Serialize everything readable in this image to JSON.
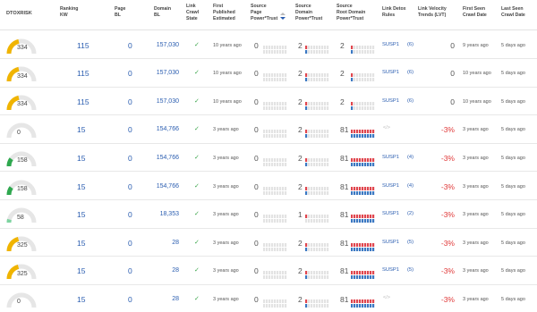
{
  "headers": {
    "dtoxrisk": "DTOXRISK",
    "ranking_kw": [
      "Ranking",
      "KW"
    ],
    "page_bl": [
      "Page",
      "BL"
    ],
    "domain_bl": [
      "Domain",
      "BL"
    ],
    "link_crawl_state": [
      "Link",
      "Crawl",
      "State"
    ],
    "first_published": [
      "First",
      "Published",
      "Estimated"
    ],
    "source_page_pt": [
      "Source",
      "Page",
      "Power*Trust"
    ],
    "source_domain_pt": [
      "Source",
      "Domain",
      "Power*Trust"
    ],
    "source_root_domain_pt": [
      "Source",
      "Root Domain",
      "Power*Trust"
    ],
    "link_detox_rules": [
      "Link Detox",
      "Rules"
    ],
    "link_velocity": [
      "Link Velocity",
      "Trends (LVT)"
    ],
    "first_seen": [
      "First Seen",
      "Crawl Date"
    ],
    "last_seen": [
      "Last Seen",
      "Crawl Date"
    ]
  },
  "colors": {
    "gauge_track": "#e6e6e6",
    "gauge_yellow": "#f0b400",
    "gauge_green": "#2fa84f",
    "gauge_lightgreen": "#7dd3a0",
    "link_blue": "#2a5db0",
    "lvt_red": "#e03a3a",
    "bar_red": "#e0464e",
    "bar_blue": "#3b78c2",
    "bar_empty": "#e3e3e3",
    "check_green": "#3aa54a"
  },
  "rows": [
    {
      "risk": "334",
      "risk_level": 0.43,
      "risk_color": "yellow",
      "ranking_kw": "115",
      "page_bl": "0",
      "domain_bl": "157,030",
      "crawl_state": "ok",
      "first_published": "10 years ago",
      "page_pt": "0",
      "domain_pt": "2",
      "root_pt": "2",
      "domain_red": 1,
      "domain_blue": 1,
      "root_red": 1,
      "root_blue": 1,
      "rules": "SUSP1",
      "rules_count": "(6)",
      "lvt": "0",
      "first_seen": "9 years ago",
      "last_seen": "5 days ago"
    },
    {
      "risk": "334",
      "risk_level": 0.43,
      "risk_color": "yellow",
      "ranking_kw": "115",
      "page_bl": "0",
      "domain_bl": "157,030",
      "crawl_state": "ok",
      "first_published": "10 years ago",
      "page_pt": "0",
      "domain_pt": "2",
      "root_pt": "2",
      "domain_red": 1,
      "domain_blue": 1,
      "root_red": 1,
      "root_blue": 1,
      "rules": "SUSP1",
      "rules_count": "(6)",
      "lvt": "0",
      "first_seen": "10 years ago",
      "last_seen": "5 days ago"
    },
    {
      "risk": "334",
      "risk_level": 0.43,
      "risk_color": "yellow",
      "ranking_kw": "115",
      "page_bl": "0",
      "domain_bl": "157,030",
      "crawl_state": "ok",
      "first_published": "10 years ago",
      "page_pt": "0",
      "domain_pt": "2",
      "root_pt": "2",
      "domain_red": 1,
      "domain_blue": 1,
      "root_red": 1,
      "root_blue": 1,
      "rules": "SUSP1",
      "rules_count": "(6)",
      "lvt": "0",
      "first_seen": "10 years ago",
      "last_seen": "5 days ago"
    },
    {
      "risk": "0",
      "risk_level": 0.0,
      "risk_color": "yellow",
      "ranking_kw": "15",
      "page_bl": "0",
      "domain_bl": "154,766",
      "crawl_state": "ok",
      "first_published": "3 years ago",
      "page_pt": "0",
      "domain_pt": "2",
      "root_pt": "81",
      "domain_red": 1,
      "domain_blue": 1,
      "root_red": 9,
      "root_blue": 9,
      "rules": "",
      "rules_count": "",
      "lvt": "-3%",
      "first_seen": "3 years ago",
      "last_seen": "5 days ago"
    },
    {
      "risk": "158",
      "risk_level": 0.2,
      "risk_color": "green",
      "ranking_kw": "15",
      "page_bl": "0",
      "domain_bl": "154,766",
      "crawl_state": "ok",
      "first_published": "3 years ago",
      "page_pt": "0",
      "domain_pt": "2",
      "root_pt": "81",
      "domain_red": 1,
      "domain_blue": 1,
      "root_red": 9,
      "root_blue": 9,
      "rules": "SUSP1",
      "rules_count": "(4)",
      "lvt": "-3%",
      "first_seen": "3 years ago",
      "last_seen": "5 days ago"
    },
    {
      "risk": "158",
      "risk_level": 0.2,
      "risk_color": "green",
      "ranking_kw": "15",
      "page_bl": "0",
      "domain_bl": "154,766",
      "crawl_state": "ok",
      "first_published": "3 years ago",
      "page_pt": "0",
      "domain_pt": "2",
      "root_pt": "81",
      "domain_red": 1,
      "domain_blue": 1,
      "root_red": 9,
      "root_blue": 9,
      "rules": "SUSP1",
      "rules_count": "(4)",
      "lvt": "-3%",
      "first_seen": "3 years ago",
      "last_seen": "5 days ago"
    },
    {
      "risk": "58",
      "risk_level": 0.08,
      "risk_color": "lightgreen",
      "ranking_kw": "15",
      "page_bl": "0",
      "domain_bl": "18,353",
      "crawl_state": "ok",
      "first_published": "3 years ago",
      "page_pt": "0",
      "domain_pt": "1",
      "root_pt": "81",
      "domain_red": 1,
      "domain_blue": 0,
      "root_red": 9,
      "root_blue": 9,
      "rules": "SUSP1",
      "rules_count": "(2)",
      "lvt": "-3%",
      "first_seen": "3 years ago",
      "last_seen": "5 days ago"
    },
    {
      "risk": "325",
      "risk_level": 0.42,
      "risk_color": "yellow",
      "ranking_kw": "15",
      "page_bl": "0",
      "domain_bl": "28",
      "crawl_state": "ok",
      "first_published": "3 years ago",
      "page_pt": "0",
      "domain_pt": "2",
      "root_pt": "81",
      "domain_red": 1,
      "domain_blue": 1,
      "root_red": 9,
      "root_blue": 9,
      "rules": "SUSP1",
      "rules_count": "(5)",
      "lvt": "-3%",
      "first_seen": "3 years ago",
      "last_seen": "5 days ago"
    },
    {
      "risk": "325",
      "risk_level": 0.42,
      "risk_color": "yellow",
      "ranking_kw": "15",
      "page_bl": "0",
      "domain_bl": "28",
      "crawl_state": "ok",
      "first_published": "3 years ago",
      "page_pt": "0",
      "domain_pt": "2",
      "root_pt": "81",
      "domain_red": 1,
      "domain_blue": 1,
      "root_red": 9,
      "root_blue": 9,
      "rules": "SUSP1",
      "rules_count": "(5)",
      "lvt": "-3%",
      "first_seen": "3 years ago",
      "last_seen": "5 days ago"
    },
    {
      "risk": "0",
      "risk_level": 0.0,
      "risk_color": "yellow",
      "ranking_kw": "15",
      "page_bl": "0",
      "domain_bl": "28",
      "crawl_state": "ok",
      "first_published": "3 years ago",
      "page_pt": "0",
      "domain_pt": "2",
      "root_pt": "81",
      "domain_red": 1,
      "domain_blue": 1,
      "root_red": 9,
      "root_blue": 9,
      "rules": "",
      "rules_count": "",
      "lvt": "-3%",
      "first_seen": "3 years ago",
      "last_seen": "5 days ago"
    }
  ]
}
